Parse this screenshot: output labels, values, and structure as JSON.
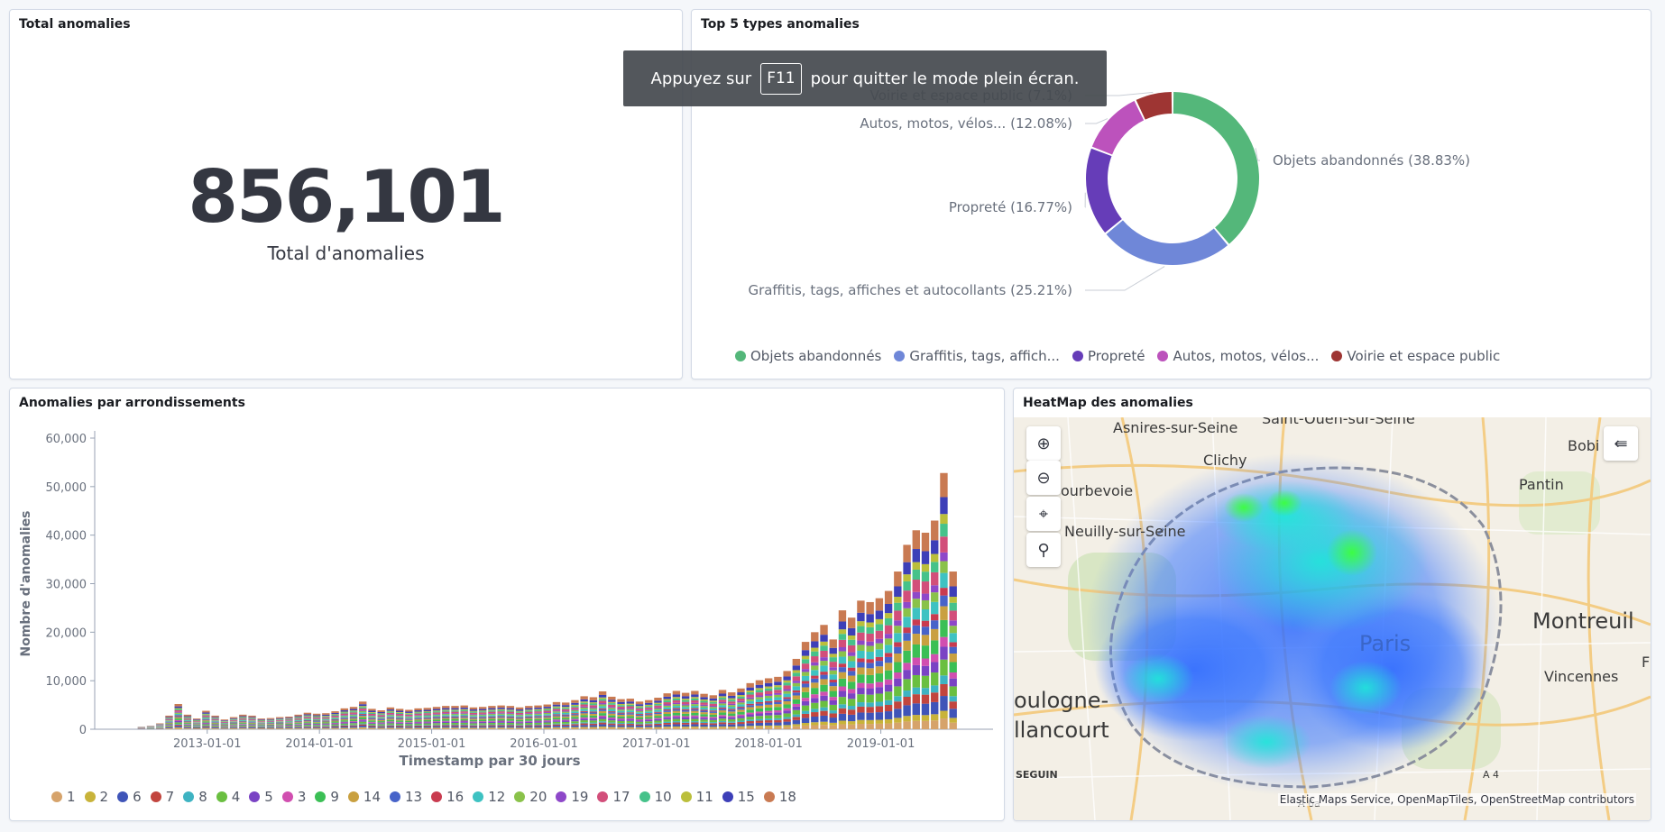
{
  "fullscreen_toast": {
    "before": "Appuyez sur",
    "key": "F11",
    "after": "pour quitter le mode plein écran."
  },
  "total_panel": {
    "title": "Total anomalies",
    "value": "856,101",
    "label": "Total d'anomalies"
  },
  "donut_panel": {
    "title": "Top 5 types anomalies",
    "slices": [
      {
        "label": "Objets abandonnés (38.83%)",
        "legend": "Objets abandonnés",
        "value": 38.83,
        "color": "#54b77a"
      },
      {
        "label": "Graffitis, tags, affiches et autocollants (25.21%)",
        "legend": "Graffitis, tags, affich...",
        "value": 25.21,
        "color": "#6f87d8"
      },
      {
        "label": "Propreté (16.77%)",
        "legend": "Propreté",
        "value": 16.77,
        "color": "#663db8"
      },
      {
        "label": "Autos, motos, vélos... (12.08%)",
        "legend": "Autos, motos, vélos...",
        "value": 12.08,
        "color": "#bc52bc"
      },
      {
        "label": "Voirie et espace public (7.1%)",
        "legend": "Voirie et espace public",
        "value": 7.1,
        "color": "#9e3533"
      }
    ]
  },
  "bar_panel": {
    "title": "Anomalies par arrondissements",
    "ylabel": "Nombre d'anomalies",
    "xlabel": "Timestamp par 30 jours",
    "legend": [
      {
        "name": "1",
        "color": "#d6a36b"
      },
      {
        "name": "2",
        "color": "#c8b33a"
      },
      {
        "name": "6",
        "color": "#3f54b8"
      },
      {
        "name": "7",
        "color": "#c2453e"
      },
      {
        "name": "8",
        "color": "#3eb3c2"
      },
      {
        "name": "4",
        "color": "#6abf40"
      },
      {
        "name": "5",
        "color": "#7a43c4"
      },
      {
        "name": "3",
        "color": "#d14fb0"
      },
      {
        "name": "9",
        "color": "#3bbf55"
      },
      {
        "name": "14",
        "color": "#c9a040"
      },
      {
        "name": "13",
        "color": "#4763c9"
      },
      {
        "name": "16",
        "color": "#c93b4f"
      },
      {
        "name": "12",
        "color": "#3ec2c2"
      },
      {
        "name": "20",
        "color": "#8ac24a"
      },
      {
        "name": "19",
        "color": "#8e48c9"
      },
      {
        "name": "17",
        "color": "#d24e7a"
      },
      {
        "name": "10",
        "color": "#46c28a"
      },
      {
        "name": "11",
        "color": "#bbbf3b"
      },
      {
        "name": "15",
        "color": "#3d3fb8"
      },
      {
        "name": "18",
        "color": "#c97a52"
      }
    ]
  },
  "chart_data": {
    "type": "bar",
    "stacked": true,
    "ylabel": "Nombre d'anomalies",
    "xlabel": "Timestamp par 30 jours",
    "ylim": [
      0,
      60000
    ],
    "yticks": [
      "0",
      "10,000",
      "20,000",
      "30,000",
      "40,000",
      "50,000",
      "60,000"
    ],
    "xticks": [
      "2013-01-01",
      "2014-01-01",
      "2015-01-01",
      "2016-01-01",
      "2017-01-01",
      "2018-01-01",
      "2019-01-01"
    ],
    "grid": false,
    "legend_position": "bottom",
    "x_start": "2012-06-01",
    "bar_interval_days": 30,
    "totals": [
      500,
      700,
      1200,
      2800,
      5200,
      3000,
      2200,
      3800,
      2800,
      2000,
      2500,
      3000,
      2800,
      2200,
      2300,
      2500,
      2600,
      3000,
      3400,
      3200,
      3300,
      3700,
      4300,
      4600,
      5700,
      4200,
      3900,
      4500,
      4200,
      4000,
      4300,
      4400,
      4600,
      4800,
      4800,
      4900,
      4500,
      4600,
      4800,
      4900,
      4800,
      4500,
      4800,
      4900,
      5100,
      5600,
      5500,
      6000,
      6800,
      6600,
      7800,
      6700,
      6200,
      6300,
      5700,
      6000,
      6500,
      7400,
      7900,
      7500,
      7900,
      7300,
      7000,
      8100,
      7600,
      8400,
      9500,
      10100,
      10500,
      10800,
      12000,
      14500,
      18000,
      20000,
      21500,
      18500,
      24500,
      23000,
      26500,
      26200,
      27000,
      28500,
      32500,
      38000,
      41000,
      40500,
      43000,
      52800,
      32500
    ]
  },
  "map_panel": {
    "title": "HeatMap des anomalies",
    "attribution": "Elastic Maps Service, OpenMapTiles, OpenStreetMap contributors",
    "labels": [
      "Asnires-sur-Seine",
      "Saint-Ouen-sur-Seine",
      "Clichy",
      "ourbevoie",
      "Neuilly-sur-Seine",
      "Pantin",
      "Bobi",
      "Montreuil",
      "Vincennes",
      "Paris",
      "oulogne-",
      "llancourt",
      "SEGUIN",
      "A 4",
      "A 6a",
      "F"
    ]
  }
}
